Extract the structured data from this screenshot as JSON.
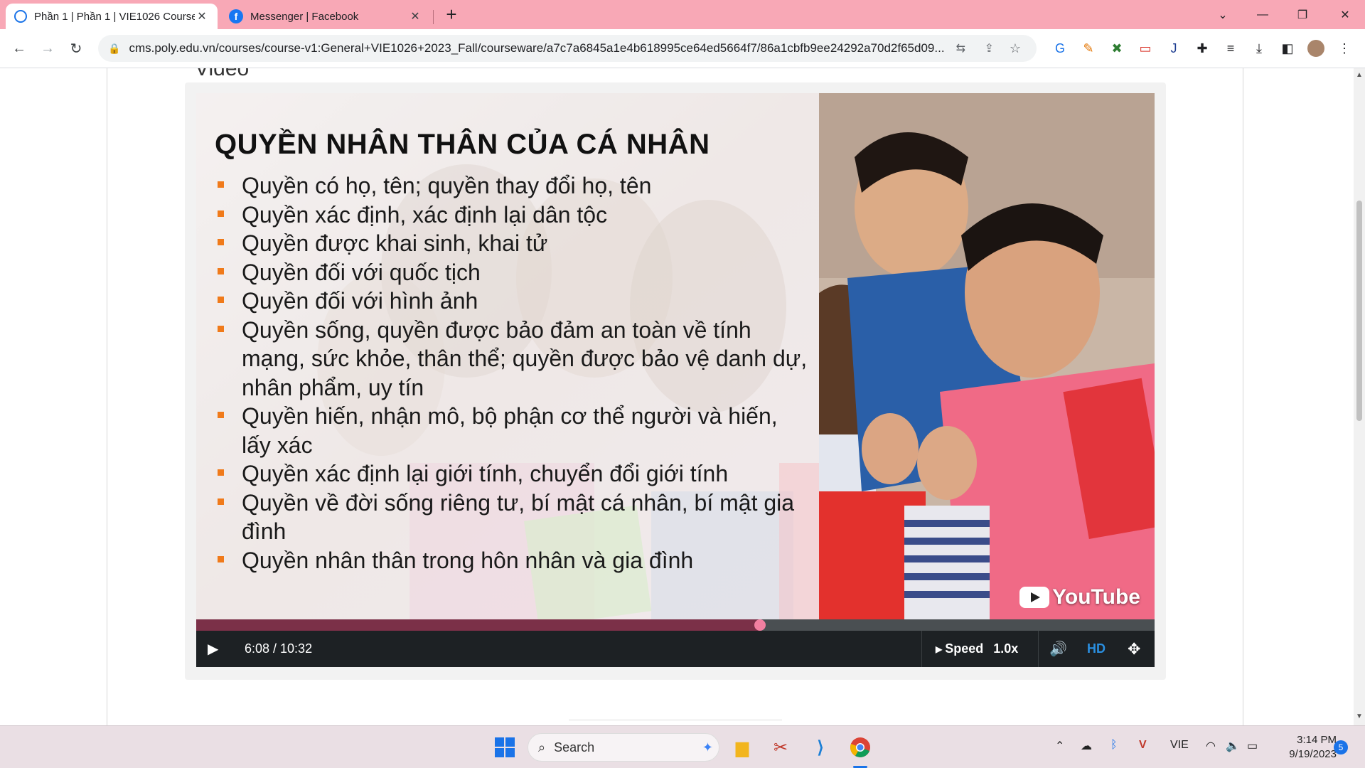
{
  "browser": {
    "tabs": [
      {
        "title": "Phần 1 | Phần 1 | VIE1026 Course",
        "active": true
      },
      {
        "title": "Messenger | Facebook",
        "active": false
      }
    ],
    "url": "cms.poly.edu.vn/courses/course-v1:General+VIE1026+2023_Fall/courseware/a7c7a6845a1e4b618995ce64ed5664f7/86a1cbfb9ee24292a70d2f65d09...",
    "accent_color": "#f8a8b6"
  },
  "page": {
    "section_heading": "Video"
  },
  "video": {
    "slide": {
      "title": "QUYỀN NHÂN THÂN CỦA CÁ NHÂN",
      "items": [
        "Quyền có họ, tên; quyền thay đổi họ, tên",
        "Quyền xác định, xác định lại dân tộc",
        "Quyền được khai sinh, khai tử",
        "Quyền đối với quốc tịch",
        "Quyền đối với hình ảnh",
        "Quyền sống, quyền được bảo đảm an toàn về tính mạng, sức khỏe, thân thể; quyền được bảo vệ danh dự, nhân phẩm, uy tín",
        "Quyền hiến, nhận mô, bộ phận cơ thể người và hiến, lấy xác",
        "Quyền xác định lại giới tính, chuyển đổi giới tính",
        "Quyền về đời sống riêng tư, bí mật cá nhân, bí mật gia đình",
        "Quyền nhân thân trong hôn nhân và gia đình"
      ]
    },
    "youtube_label": "YouTube",
    "time_display": "6:08 / 10:32",
    "progress_fraction": 0.588,
    "speed_label": "Speed",
    "speed_value": "1.0x",
    "hd_label": "HD"
  },
  "taskbar": {
    "search_placeholder": "Search",
    "language": "VIE",
    "time": "3:14 PM",
    "date": "9/19/2023",
    "notification_count": "5"
  }
}
